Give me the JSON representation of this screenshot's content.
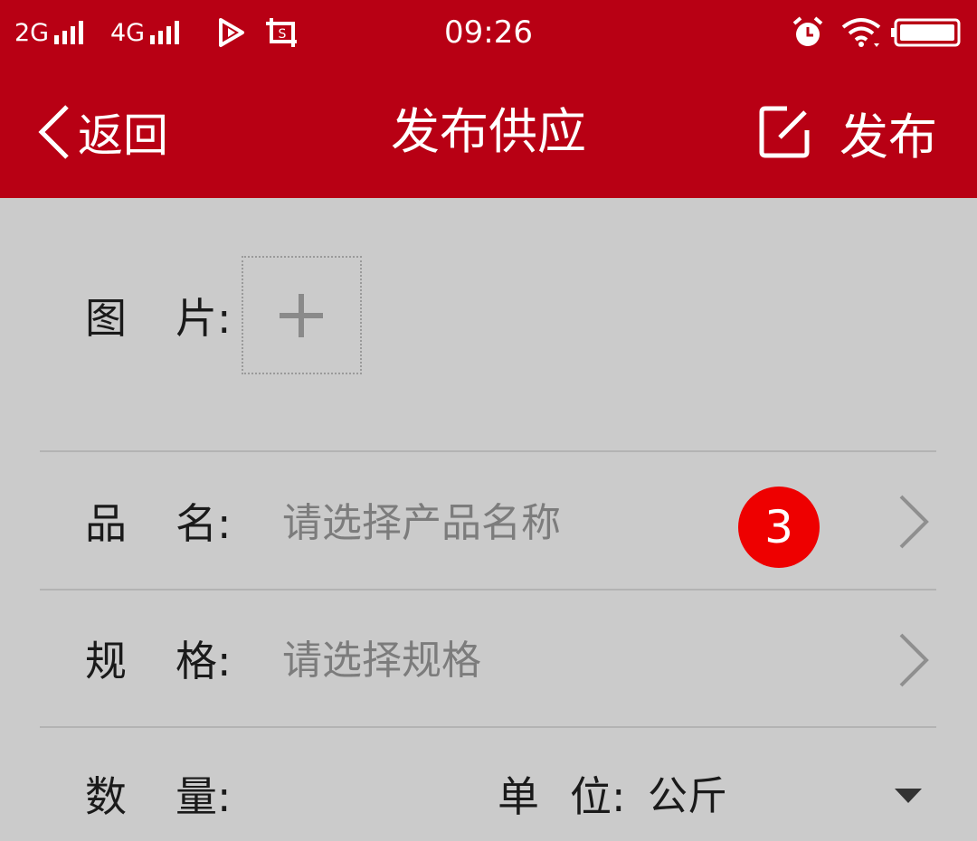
{
  "status_bar": {
    "network1": "2G",
    "network2": "4G",
    "time": "09:26",
    "icons": [
      "signal-icon",
      "video-icon",
      "screenshot-icon",
      "alarm-icon",
      "wifi-icon",
      "battery-icon"
    ]
  },
  "header": {
    "back_label": "返回",
    "title": "发布供应",
    "publish_label": "发布"
  },
  "form": {
    "image": {
      "c1": "图",
      "c2": "片:"
    },
    "product_name": {
      "c1": "品",
      "c2": "名:",
      "placeholder": "请选择产品名称",
      "badge": "3"
    },
    "spec": {
      "c1": "规",
      "c2": "格:",
      "placeholder": "请选择规格"
    },
    "quantity": {
      "c1": "数",
      "c2": "量:"
    },
    "unit": {
      "c1": "单",
      "c2": "位:",
      "value": "公斤"
    }
  },
  "colors": {
    "header_bg": "#b80014",
    "page_bg": "#cbcbcb",
    "badge": "#ee0000"
  }
}
